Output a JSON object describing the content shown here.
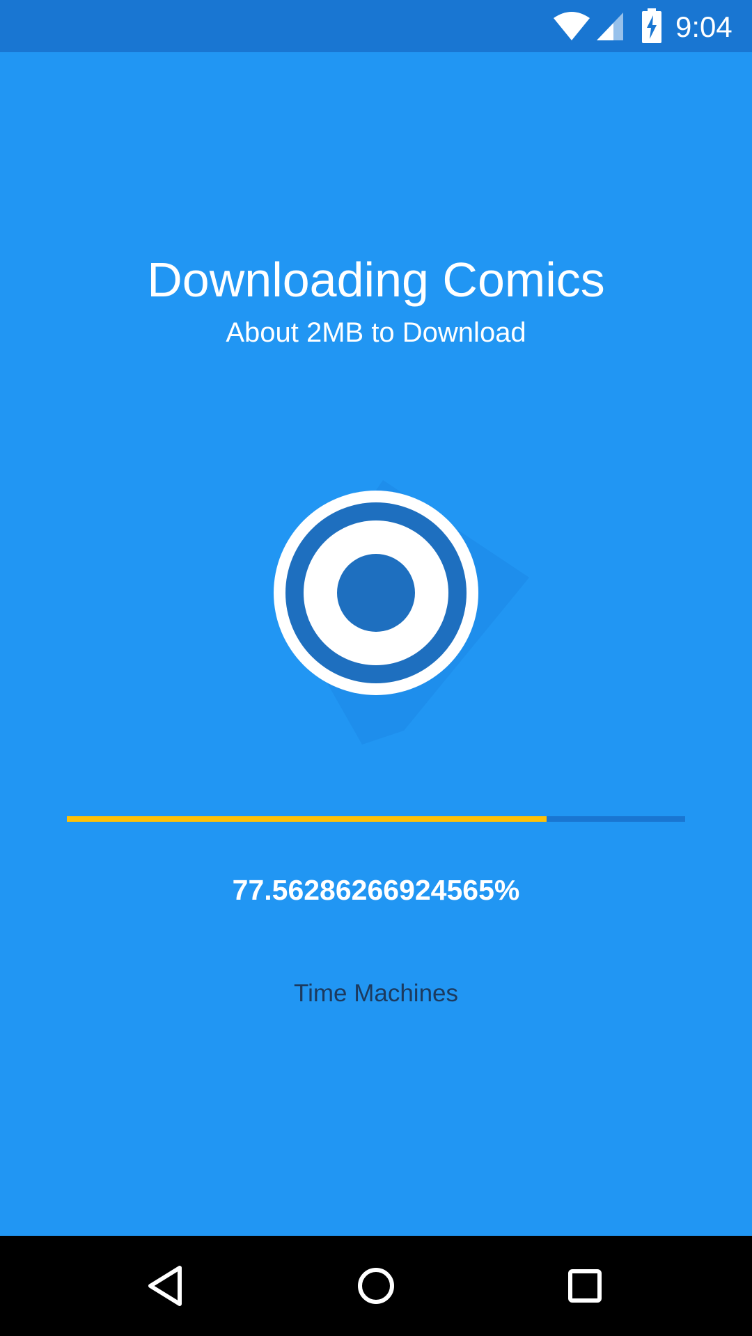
{
  "status_bar": {
    "time": "9:04",
    "icons": [
      "wifi-icon",
      "signal-icon",
      "battery-charging-icon"
    ]
  },
  "header": {
    "title": "Downloading Comics",
    "subtitle": "About 2MB to Download"
  },
  "logo": {
    "icon": "target-logo-icon"
  },
  "progress": {
    "value_percent": 77.56286266924565,
    "label": "77.56286266924565%"
  },
  "current_item": {
    "label": "Time Machines"
  },
  "nav_bar": {
    "buttons": [
      "back-icon",
      "home-icon",
      "recents-icon"
    ]
  },
  "colors": {
    "background": "#2196F3",
    "status_bar": "#1976D2",
    "progress_track": "#1976D2",
    "progress_fill": "#FFC107",
    "nav_bar": "#000000"
  }
}
